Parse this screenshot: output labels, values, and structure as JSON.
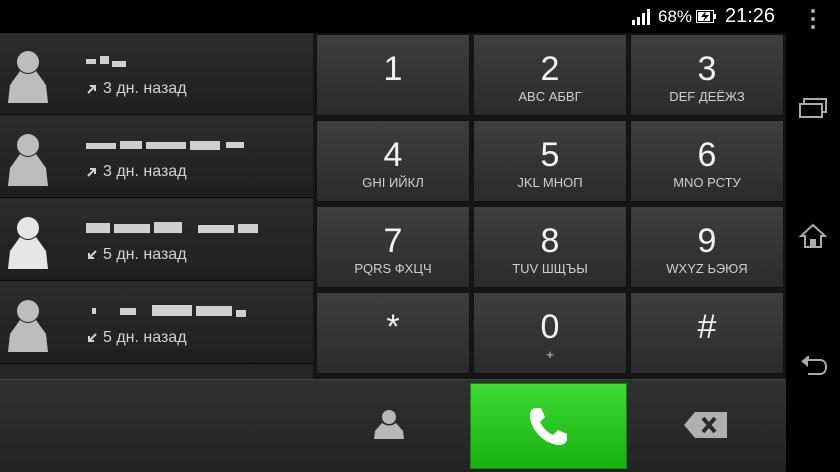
{
  "status_bar": {
    "battery_percent": "68%",
    "time": "21:26",
    "icons": [
      "signal-icon",
      "battery-charging-icon"
    ]
  },
  "call_log": {
    "items": [
      {
        "meta": "3 дн. назад",
        "direction_icon": "outgoing-call-icon",
        "name_hidden": true
      },
      {
        "meta": "3 дн. назад",
        "direction_icon": "outgoing-call-icon",
        "name_hidden": true
      },
      {
        "meta": "5 дн. назад",
        "direction_icon": "incoming-call-icon",
        "name_hidden": true
      },
      {
        "meta": "5 дн. назад",
        "direction_icon": "incoming-call-icon",
        "name_hidden": true
      }
    ]
  },
  "keypad": {
    "keys": [
      {
        "digit": "1",
        "letters": ""
      },
      {
        "digit": "2",
        "letters": "ABC АБВГ"
      },
      {
        "digit": "3",
        "letters": "DEF ДЕЁЖЗ"
      },
      {
        "digit": "4",
        "letters": "GHI ИЙКЛ"
      },
      {
        "digit": "5",
        "letters": "JKL МНОП"
      },
      {
        "digit": "6",
        "letters": "MNO РСТУ"
      },
      {
        "digit": "7",
        "letters": "PQRS ФХЦЧ"
      },
      {
        "digit": "8",
        "letters": "TUV ШЩЪЫ"
      },
      {
        "digit": "9",
        "letters": "WXYZ ЬЭЮЯ"
      },
      {
        "digit": "*",
        "letters": ""
      },
      {
        "digit": "0",
        "letters": "+"
      },
      {
        "digit": "#",
        "letters": ""
      }
    ]
  },
  "bottom_bar": {
    "icons": [
      "contacts-icon",
      "phone-call-icon",
      "backspace-icon"
    ],
    "call_color": "#22c41a"
  },
  "nav_bar": {
    "icons": [
      "menu-icon",
      "recent-apps-icon",
      "home-icon",
      "back-icon"
    ]
  }
}
